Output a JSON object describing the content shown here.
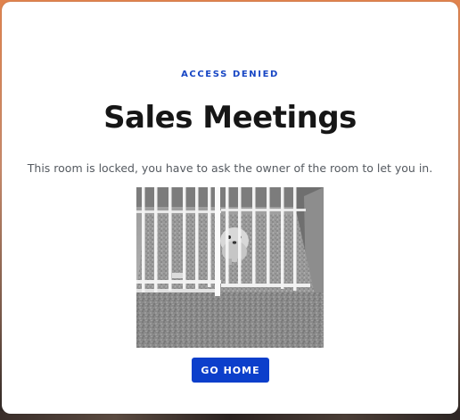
{
  "card": {
    "eyebrow": "ACCESS DENIED",
    "title": "Sales Meetings",
    "message": "This room is locked, you have to ask the owner of the room to let you in.",
    "button_label": "GO HOME",
    "image_icon": "dog-behind-gate-photo"
  },
  "colors": {
    "accent": "#0c3fcb",
    "eyebrow": "#1746c4",
    "title": "#161616",
    "message": "#555a60"
  }
}
